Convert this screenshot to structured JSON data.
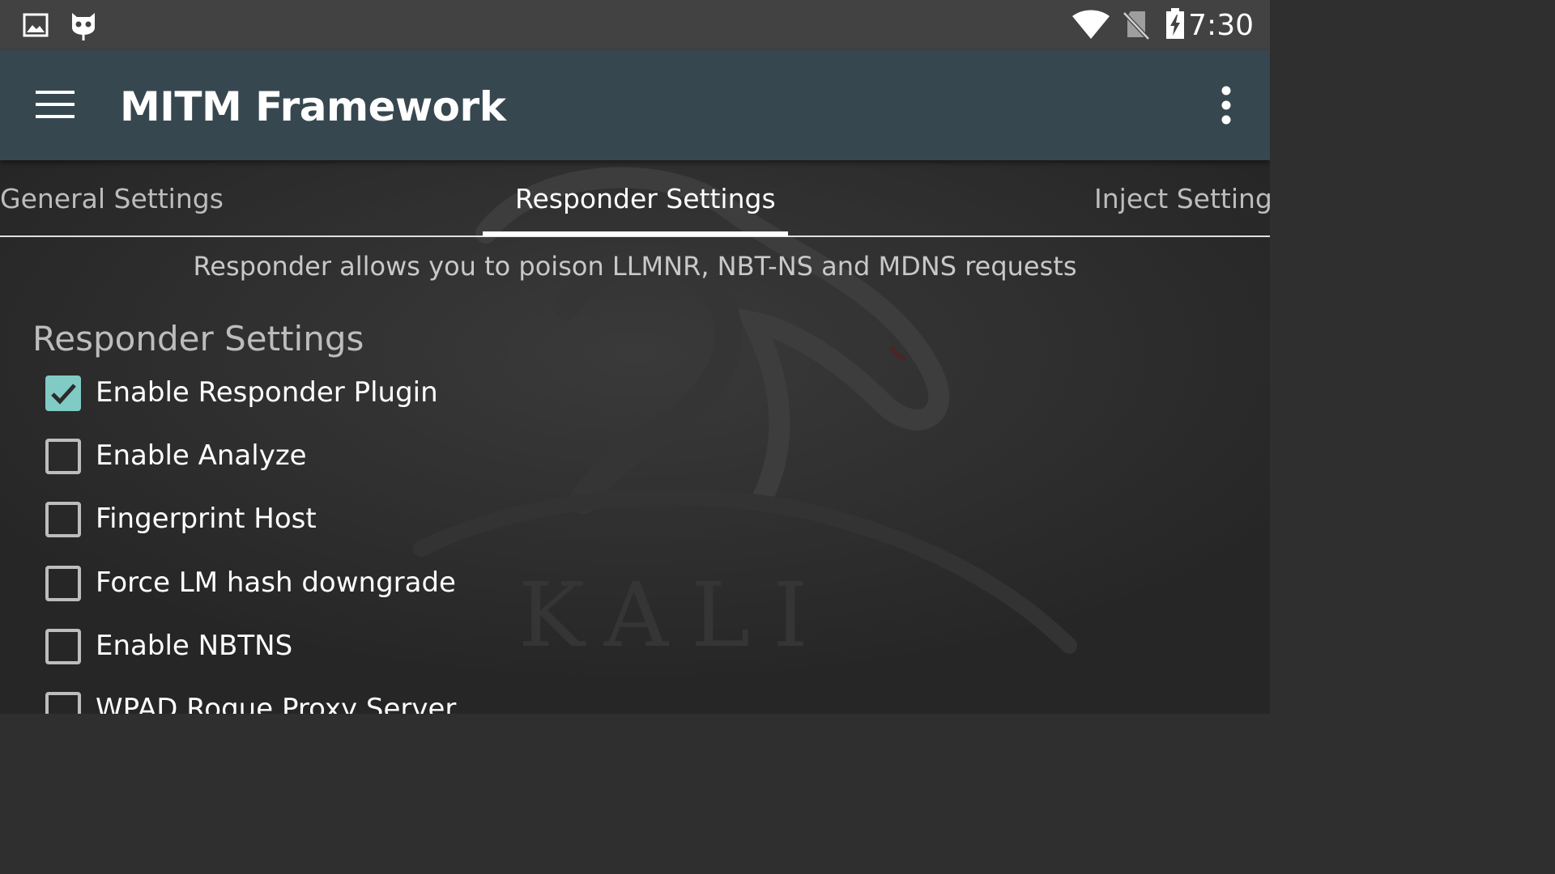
{
  "status_bar": {
    "time": "7:30",
    "icons": [
      "gallery-notification-icon",
      "cyanogen-mascot-icon",
      "wifi-icon",
      "no-sim-icon",
      "battery-charging-icon"
    ]
  },
  "app_bar": {
    "title": "MITM Framework",
    "menu_icon": "hamburger-menu-icon",
    "overflow_icon": "more-vert-icon",
    "color": "#37474f"
  },
  "tabs": [
    {
      "label": "General Settings",
      "active": false
    },
    {
      "label": "Responder Settings",
      "active": true
    },
    {
      "label": "Inject Settings",
      "active": false
    }
  ],
  "description": "Responder allows you to poison LLMNR, NBT-NS and MDNS requests",
  "section": {
    "title": "Responder Settings",
    "options": [
      {
        "label": "Enable Responder Plugin",
        "checked": true
      },
      {
        "label": "Enable Analyze",
        "checked": false
      },
      {
        "label": "Fingerprint Host",
        "checked": false
      },
      {
        "label": "Force LM hash downgrade",
        "checked": false
      },
      {
        "label": "Enable NBTNS",
        "checked": false
      },
      {
        "label": "WPAD Rogue Proxy Server",
        "checked": false
      }
    ]
  },
  "colors": {
    "accent": "#80cbc4",
    "background": "#2b2b2b",
    "status_bar": "#424242"
  }
}
